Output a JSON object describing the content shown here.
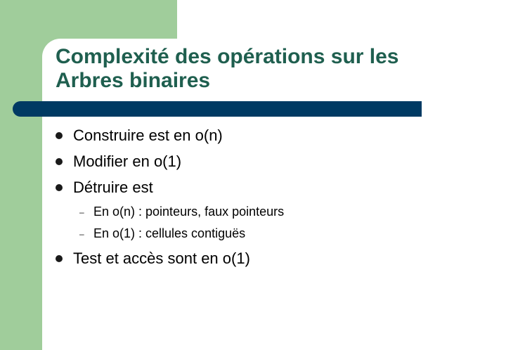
{
  "slide": {
    "title_lines": [
      "Complexité des opérations sur les",
      "Arbres binaires"
    ],
    "bullets": [
      "Construire est en o(n)",
      "Modifier en o(1)",
      "Détruire est",
      "Test et accès sont en o(1)"
    ],
    "sub_dash": "–",
    "sub_bullets": [
      "En o(n) : pointeurs, faux pointeurs",
      "En o(1) : cellules contiguës"
    ]
  },
  "colors": {
    "green_block": "#a0cd9b",
    "title": "#1f5f4f",
    "bar": "#003a63"
  }
}
